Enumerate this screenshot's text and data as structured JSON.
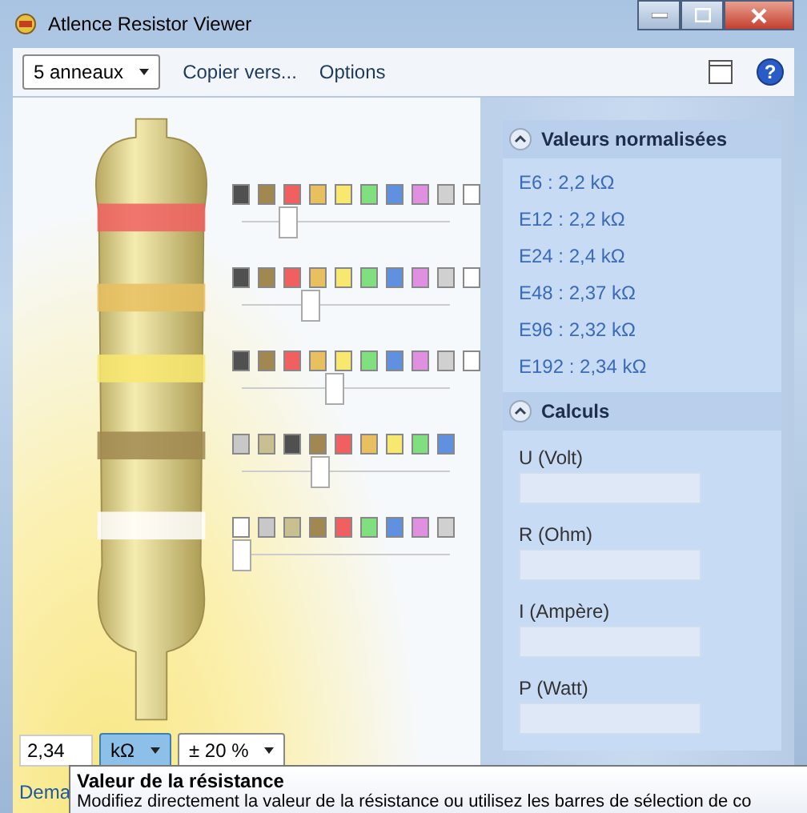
{
  "window": {
    "title": "Atlence Resistor Viewer"
  },
  "toolbar": {
    "ring_select": "5 anneaux",
    "menu": [
      "Copier vers...",
      "Options"
    ],
    "help": "?"
  },
  "bands": [
    {
      "level": 0.222,
      "swatches": [
        {
          "color": "#505050"
        },
        {
          "color": "#a08850"
        },
        {
          "color": "#f06060"
        },
        {
          "color": "#e8c060"
        },
        {
          "color": "#f8e870"
        },
        {
          "color": "#80e080"
        },
        {
          "color": "#6090e0"
        },
        {
          "color": "#e090e0"
        },
        {
          "color": "#d0d0d0"
        },
        {
          "color": "#ffffff"
        }
      ]
    },
    {
      "level": 0.333,
      "swatches": [
        {
          "color": "#505050"
        },
        {
          "color": "#a08850"
        },
        {
          "color": "#f06060"
        },
        {
          "color": "#e8c060"
        },
        {
          "color": "#f8e870"
        },
        {
          "color": "#80e080"
        },
        {
          "color": "#6090e0"
        },
        {
          "color": "#e090e0"
        },
        {
          "color": "#d0d0d0"
        },
        {
          "color": "#ffffff"
        }
      ]
    },
    {
      "level": 0.444,
      "swatches": [
        {
          "color": "#505050"
        },
        {
          "color": "#a08850"
        },
        {
          "color": "#f06060"
        },
        {
          "color": "#e8c060"
        },
        {
          "color": "#f8e870"
        },
        {
          "color": "#80e080"
        },
        {
          "color": "#6090e0"
        },
        {
          "color": "#e090e0"
        },
        {
          "color": "#d0d0d0"
        },
        {
          "color": "#ffffff"
        }
      ]
    },
    {
      "level": 0.375,
      "swatches": [
        {
          "color": "#c8c8c8"
        },
        {
          "color": "#c8c090"
        },
        {
          "color": "#505050"
        },
        {
          "color": "#a08850"
        },
        {
          "color": "#f06060"
        },
        {
          "color": "#e8c060"
        },
        {
          "color": "#f8e870"
        },
        {
          "color": "#80e080"
        },
        {
          "color": "#6090e0"
        }
      ]
    },
    {
      "level": 0,
      "swatches": [
        {
          "color": "#ffffff"
        },
        {
          "color": "#c8c8c8"
        },
        {
          "color": "#c8c090"
        },
        {
          "color": "#a08850"
        },
        {
          "color": "#f06060"
        },
        {
          "color": "#80e080"
        },
        {
          "color": "#6090e0"
        },
        {
          "color": "#e090e0"
        },
        {
          "color": "#d0d0d0"
        }
      ]
    }
  ],
  "value": {
    "value": "2,34",
    "unit": "kΩ",
    "tolerance": "± 20 %"
  },
  "link": "Dema",
  "tooltip": {
    "title": "Valeur de la résistance",
    "text": "Modifiez directement la valeur de la résistance ou utilisez les barres de sélection de co"
  },
  "sections": [
    {
      "kind": "list",
      "title": "Valeurs normalisées",
      "expanded": true,
      "items": [
        "E6 : 2,2 kΩ",
        "E12 : 2,2 kΩ",
        "E24 : 2,4 kΩ",
        "E48 : 2,37 kΩ",
        "E96 : 2,32 kΩ",
        "E192 : 2,34 kΩ"
      ]
    },
    {
      "kind": "fields",
      "title": "Calculs",
      "expanded": true,
      "items": [
        "U (Volt)",
        "R (Ohm)",
        "I (Ampère)",
        "P (Watt)"
      ]
    }
  ]
}
